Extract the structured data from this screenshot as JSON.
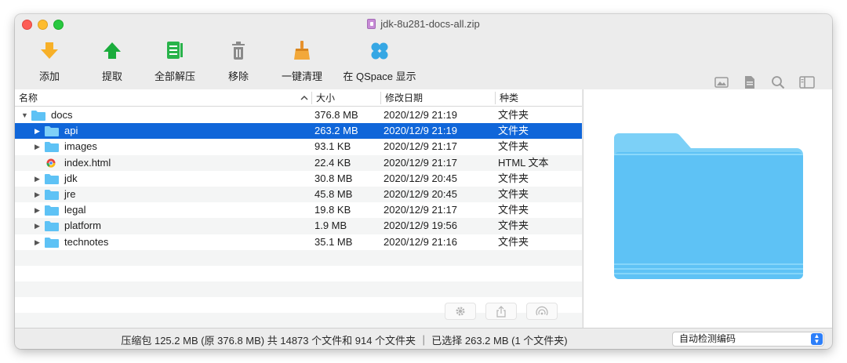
{
  "window": {
    "title": "jdk-8u281-docs-all.zip"
  },
  "toolbar": {
    "add": "添加",
    "extract": "提取",
    "extract_all": "全部解压",
    "remove": "移除",
    "clean": "一键清理",
    "show_qspace": "在 QSpace 显示"
  },
  "columns": {
    "name": "名称",
    "size": "大小",
    "modified": "修改日期",
    "kind": "种类",
    "sort_indicator": "^"
  },
  "rows": [
    {
      "name": "docs",
      "size": "376.8 MB",
      "date": "2020/12/9 21:19",
      "kind": "文件夹",
      "icon": "folder-icon",
      "expander": "▼"
    },
    {
      "name": "api",
      "size": "263.2 MB",
      "date": "2020/12/9 21:19",
      "kind": "文件夹",
      "icon": "folder-icon",
      "expander": "▶",
      "selected": true
    },
    {
      "name": "images",
      "size": "93.1 KB",
      "date": "2020/12/9 21:17",
      "kind": "文件夹",
      "icon": "folder-icon",
      "expander": "▶"
    },
    {
      "name": "index.html",
      "size": "22.4 KB",
      "date": "2020/12/9 21:17",
      "kind": "HTML 文本",
      "icon": "html-file-icon",
      "expander": ""
    },
    {
      "name": "jdk",
      "size": "30.8 MB",
      "date": "2020/12/9 20:45",
      "kind": "文件夹",
      "icon": "folder-icon",
      "expander": "▶"
    },
    {
      "name": "jre",
      "size": "45.8 MB",
      "date": "2020/12/9 20:45",
      "kind": "文件夹",
      "icon": "folder-icon",
      "expander": "▶"
    },
    {
      "name": "legal",
      "size": "19.8 KB",
      "date": "2020/12/9 21:17",
      "kind": "文件夹",
      "icon": "folder-icon",
      "expander": "▶"
    },
    {
      "name": "platform",
      "size": "1.9 MB",
      "date": "2020/12/9 19:56",
      "kind": "文件夹",
      "icon": "folder-icon",
      "expander": "▶"
    },
    {
      "name": "technotes",
      "size": "35.1 MB",
      "date": "2020/12/9 21:16",
      "kind": "文件夹",
      "icon": "folder-icon",
      "expander": "▶"
    }
  ],
  "status": {
    "text": "压缩包 125.2 MB (原 376.8 MB) 共 14873 个文件和 914 个文件夹 ｜ 已选择 263.2 MB (1 个文件夹)",
    "encoding": "自动检测编码"
  },
  "colors": {
    "selection": "#1066d9",
    "folder": "#5ec2f5",
    "accent": "#2d7ff9"
  }
}
